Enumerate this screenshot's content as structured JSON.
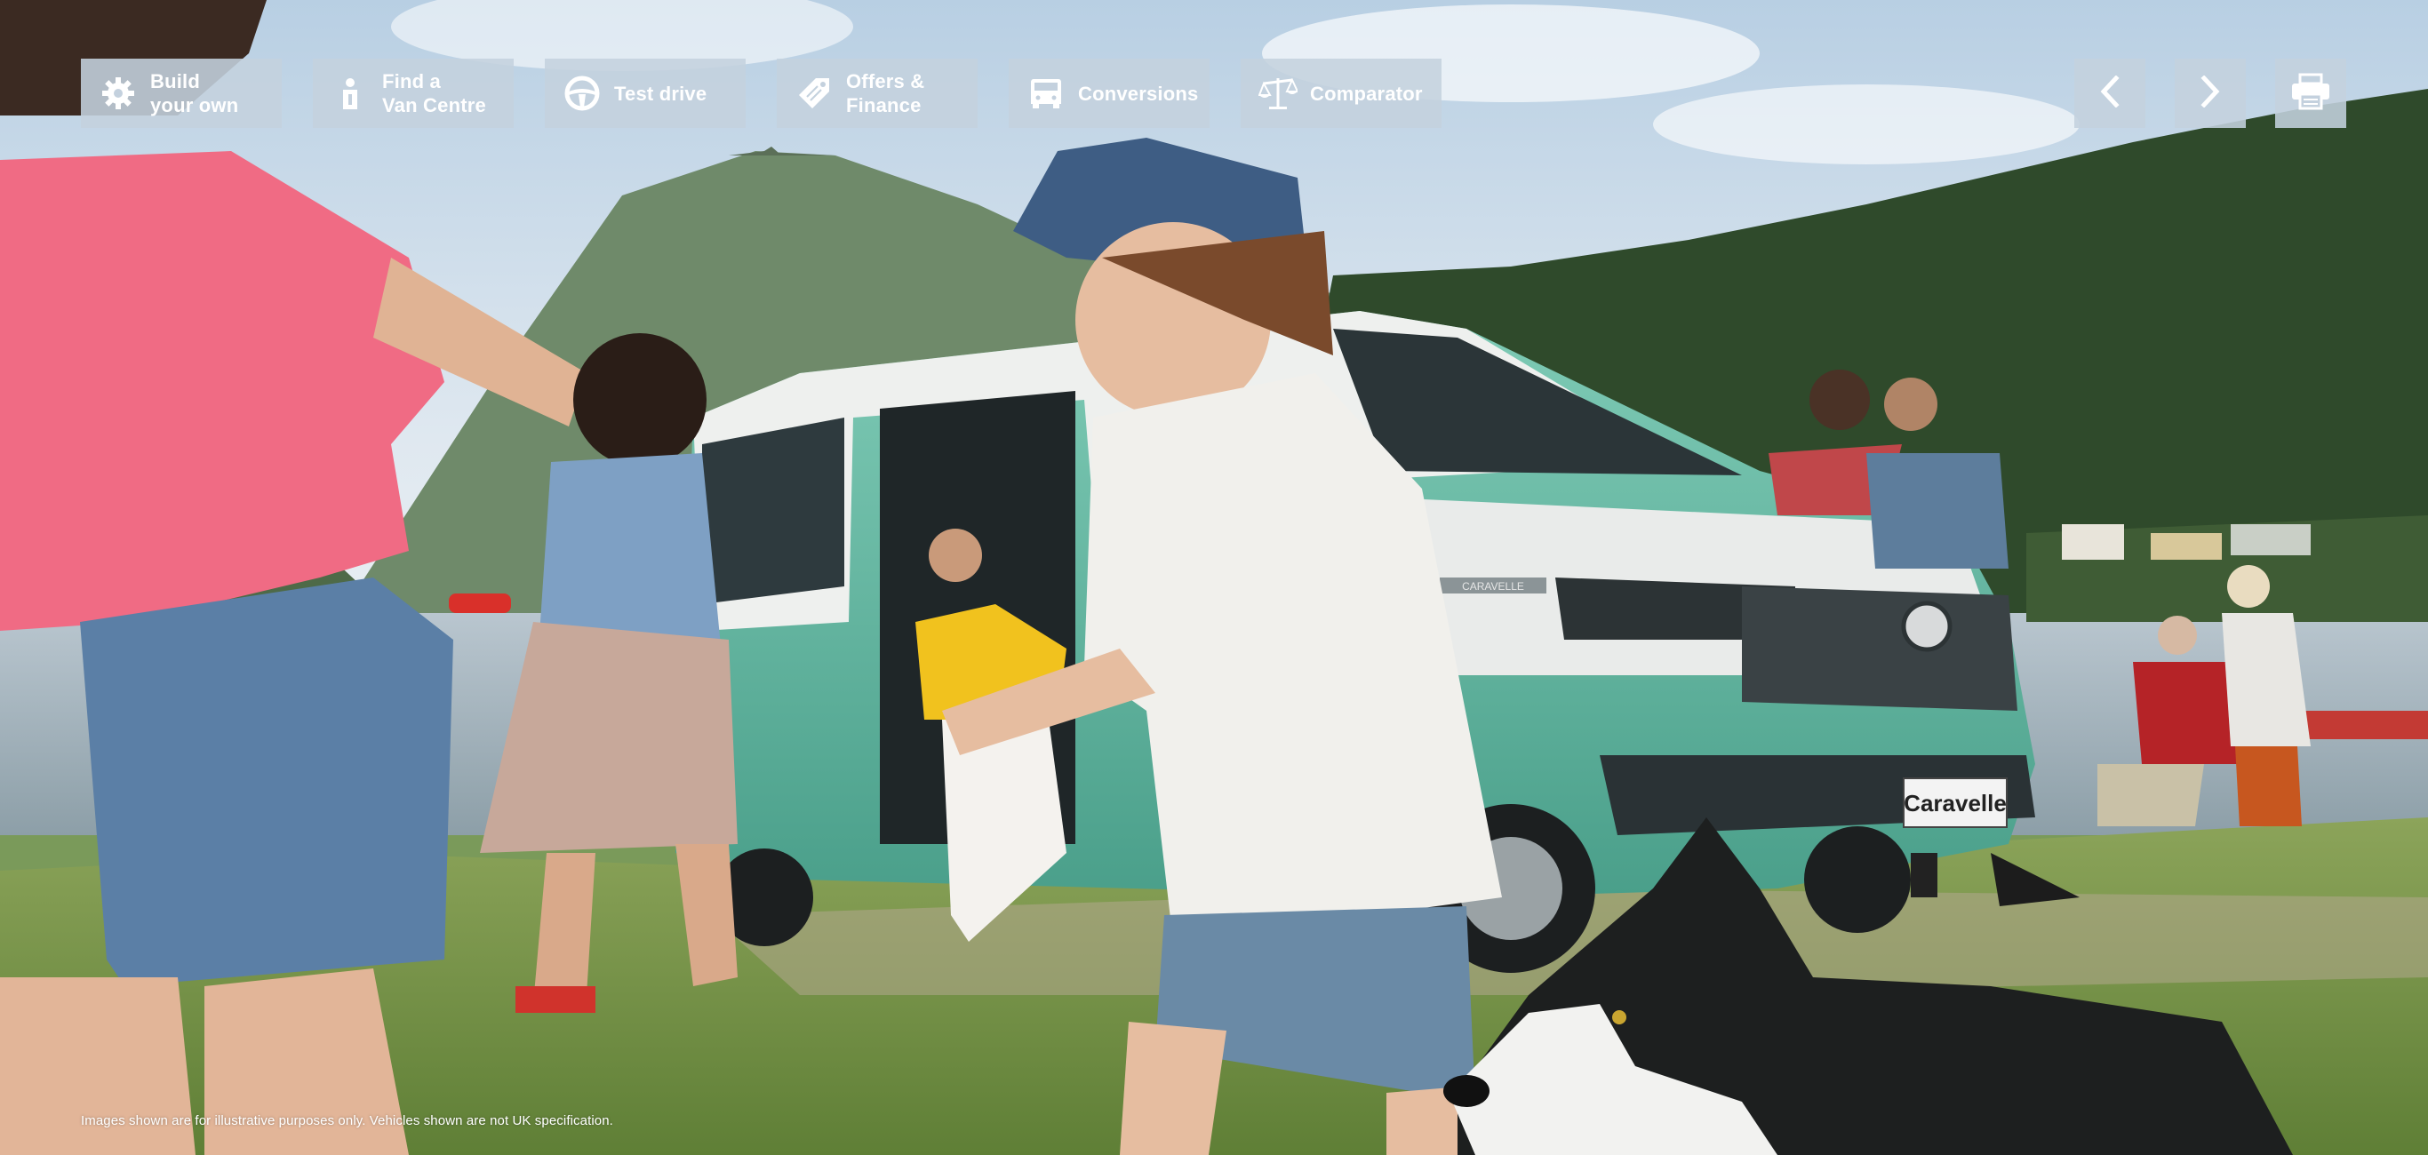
{
  "nav": {
    "items": [
      {
        "label": "Build\nyour own",
        "icon": "gear-icon"
      },
      {
        "label": "Find a\nVan Centre",
        "icon": "person-info-icon"
      },
      {
        "label": "Test drive",
        "icon": "steering-wheel-icon"
      },
      {
        "label": "Offers &\nFinance",
        "icon": "price-tag-icon"
      },
      {
        "label": "Conversions",
        "icon": "van-icon"
      },
      {
        "label": "Comparator",
        "icon": "scales-icon"
      }
    ]
  },
  "controls": {
    "prev": {
      "icon": "chevron-left-icon"
    },
    "next": {
      "icon": "chevron-right-icon"
    },
    "print": {
      "icon": "printer-icon"
    }
  },
  "hero": {
    "plate_text": "Caravelle",
    "badge_text": "CARAVELLE"
  },
  "disclaimer": "Images shown are for illustrative purposes only. Vehicles shown are not UK specification.",
  "colors": {
    "nav_bg": "#c4d1de",
    "nav_text": "#ffffff",
    "van_body": "#5fb8a2",
    "sky": "#c9d9e8"
  }
}
